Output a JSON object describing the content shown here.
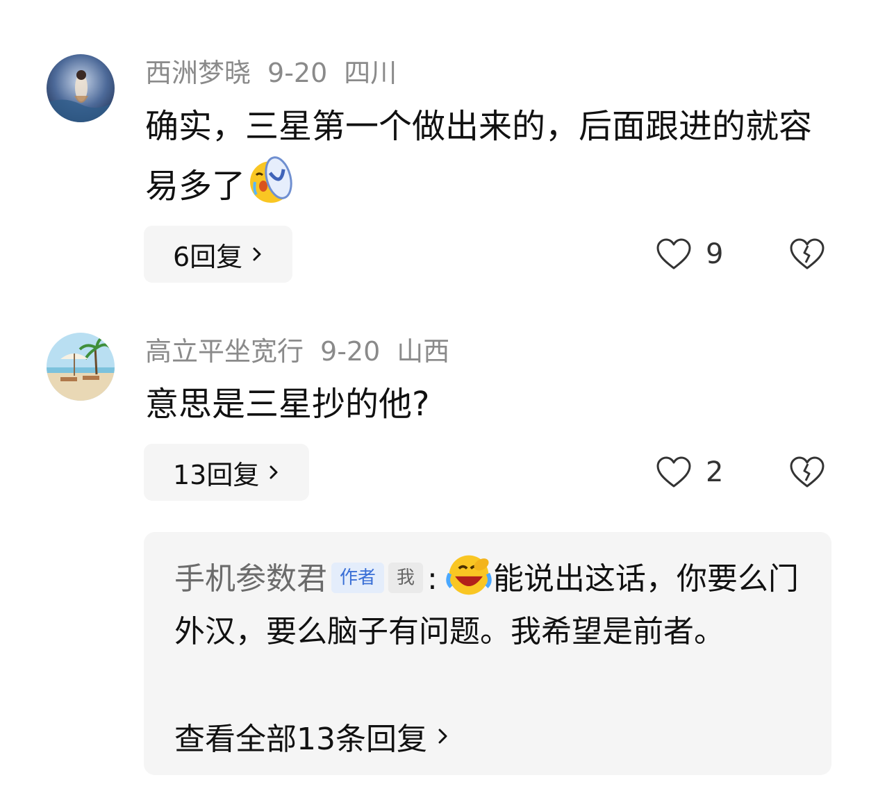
{
  "comments": [
    {
      "author": "西洲梦晓",
      "date": "9-20",
      "location": "四川",
      "text": "确实，三星第一个做出来的，后面跟进的就容易多了",
      "emoji": "crying-flip-flop-emoji",
      "replies_label": "6回复",
      "likes": "9"
    },
    {
      "author": "高立平坐宽行",
      "date": "9-20",
      "location": "山西",
      "text": "意思是三星抄的他?",
      "replies_label": "13回复",
      "likes": "2"
    }
  ],
  "sub_reply": {
    "author": "手机参数君",
    "tag_author": "作者",
    "tag_me": "我",
    "colon": ":",
    "emoji": "laughing-crying-emoji",
    "text": "能说出这话，你要么门外汉，要么脑子有问题。我希望是前者。",
    "view_all_label": "查看全部13条回复"
  },
  "colors": {
    "meta_gray": "#8a8a8a",
    "button_bg": "#f5f5f5",
    "author_tag_bg": "#e4edfb",
    "author_tag_text": "#3a6fd6"
  }
}
